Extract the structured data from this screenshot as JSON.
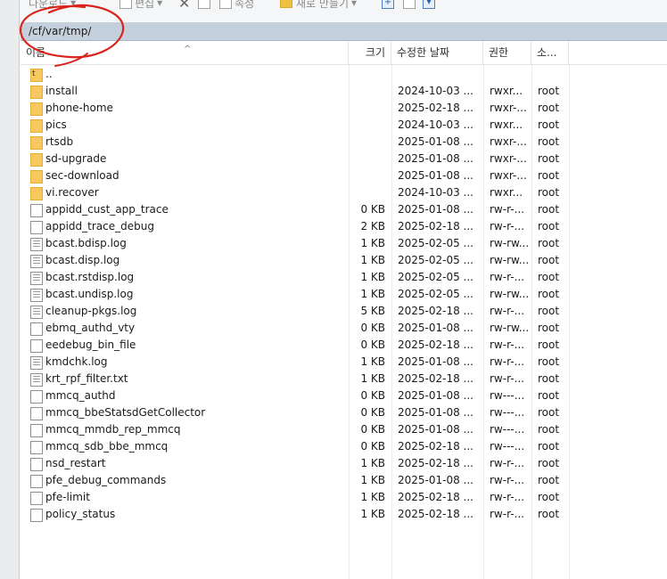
{
  "toolbar": {
    "edit_label": "편집",
    "props_label": "속성",
    "new_folder_label": "새로 만들기",
    "cut_label": "다운로드"
  },
  "path": {
    "current": "/cf/var/tmp/"
  },
  "columns": {
    "name": "이름",
    "size": "크기",
    "modified": "수정한 날짜",
    "perm": "권한",
    "owner": "소..."
  },
  "entries": [
    {
      "name": "..",
      "type": "up",
      "size": "",
      "date": "",
      "perm": "",
      "owner": ""
    },
    {
      "name": "install",
      "type": "folder",
      "size": "",
      "date": "2024-10-03 ...",
      "perm": "rwxr...",
      "owner": "root"
    },
    {
      "name": "phone-home",
      "type": "folder",
      "size": "",
      "date": "2025-02-18 ...",
      "perm": "rwxr-...",
      "owner": "root"
    },
    {
      "name": "pics",
      "type": "folder",
      "size": "",
      "date": "2024-10-03 ...",
      "perm": "rwxr...",
      "owner": "root"
    },
    {
      "name": "rtsdb",
      "type": "folder",
      "size": "",
      "date": "2025-01-08 ...",
      "perm": "rwxr-...",
      "owner": "root"
    },
    {
      "name": "sd-upgrade",
      "type": "folder",
      "size": "",
      "date": "2025-01-08 ...",
      "perm": "rwxr-...",
      "owner": "root"
    },
    {
      "name": "sec-download",
      "type": "folder",
      "size": "",
      "date": "2025-01-08 ...",
      "perm": "rwxr-...",
      "owner": "root"
    },
    {
      "name": "vi.recover",
      "type": "folder",
      "size": "",
      "date": "2024-10-03 ...",
      "perm": "rwxr...",
      "owner": "root"
    },
    {
      "name": "appidd_cust_app_trace",
      "type": "file",
      "size": "0 KB",
      "date": "2025-01-08 ...",
      "perm": "rw-r-...",
      "owner": "root"
    },
    {
      "name": "appidd_trace_debug",
      "type": "file",
      "size": "2 KB",
      "date": "2025-02-18 ...",
      "perm": "rw-r-...",
      "owner": "root"
    },
    {
      "name": "bcast.bdisp.log",
      "type": "log",
      "size": "1 KB",
      "date": "2025-02-05 ...",
      "perm": "rw-rw...",
      "owner": "root"
    },
    {
      "name": "bcast.disp.log",
      "type": "log",
      "size": "1 KB",
      "date": "2025-02-05 ...",
      "perm": "rw-rw...",
      "owner": "root"
    },
    {
      "name": "bcast.rstdisp.log",
      "type": "log",
      "size": "1 KB",
      "date": "2025-02-05 ...",
      "perm": "rw-r-...",
      "owner": "root"
    },
    {
      "name": "bcast.undisp.log",
      "type": "log",
      "size": "1 KB",
      "date": "2025-02-05 ...",
      "perm": "rw-rw...",
      "owner": "root"
    },
    {
      "name": "cleanup-pkgs.log",
      "type": "log",
      "size": "5 KB",
      "date": "2025-02-18 ...",
      "perm": "rw-r-...",
      "owner": "root"
    },
    {
      "name": "ebmq_authd_vty",
      "type": "file",
      "size": "0 KB",
      "date": "2025-01-08 ...",
      "perm": "rw-rw...",
      "owner": "root"
    },
    {
      "name": "eedebug_bin_file",
      "type": "file",
      "size": "0 KB",
      "date": "2025-02-18 ...",
      "perm": "rw-r-...",
      "owner": "root"
    },
    {
      "name": "kmdchk.log",
      "type": "log",
      "size": "1 KB",
      "date": "2025-01-08 ...",
      "perm": "rw-r-...",
      "owner": "root"
    },
    {
      "name": "krt_rpf_filter.txt",
      "type": "log",
      "size": "1 KB",
      "date": "2025-02-18 ...",
      "perm": "rw-r-...",
      "owner": "root"
    },
    {
      "name": "mmcq_authd",
      "type": "file",
      "size": "0 KB",
      "date": "2025-01-08 ...",
      "perm": "rw---...",
      "owner": "root"
    },
    {
      "name": "mmcq_bbeStatsdGetCollector",
      "type": "file",
      "size": "0 KB",
      "date": "2025-01-08 ...",
      "perm": "rw---...",
      "owner": "root"
    },
    {
      "name": "mmcq_mmdb_rep_mmcq",
      "type": "file",
      "size": "0 KB",
      "date": "2025-01-08 ...",
      "perm": "rw---...",
      "owner": "root"
    },
    {
      "name": "mmcq_sdb_bbe_mmcq",
      "type": "file",
      "size": "0 KB",
      "date": "2025-02-18 ...",
      "perm": "rw---...",
      "owner": "root"
    },
    {
      "name": "nsd_restart",
      "type": "file",
      "size": "1 KB",
      "date": "2025-02-18 ...",
      "perm": "rw-r-...",
      "owner": "root"
    },
    {
      "name": "pfe_debug_commands",
      "type": "file",
      "size": "1 KB",
      "date": "2025-01-08 ...",
      "perm": "rw-r-...",
      "owner": "root"
    },
    {
      "name": "pfe-limit",
      "type": "file",
      "size": "1 KB",
      "date": "2025-02-18 ...",
      "perm": "rw-r-...",
      "owner": "root"
    },
    {
      "name": "policy_status",
      "type": "file",
      "size": "1 KB",
      "date": "2025-02-18 ...",
      "perm": "rw-r-...",
      "owner": "root"
    }
  ],
  "colors": {
    "path_bar": "#c5d0dd",
    "folder": "#f6c85f",
    "annotation": "#d9241c"
  }
}
